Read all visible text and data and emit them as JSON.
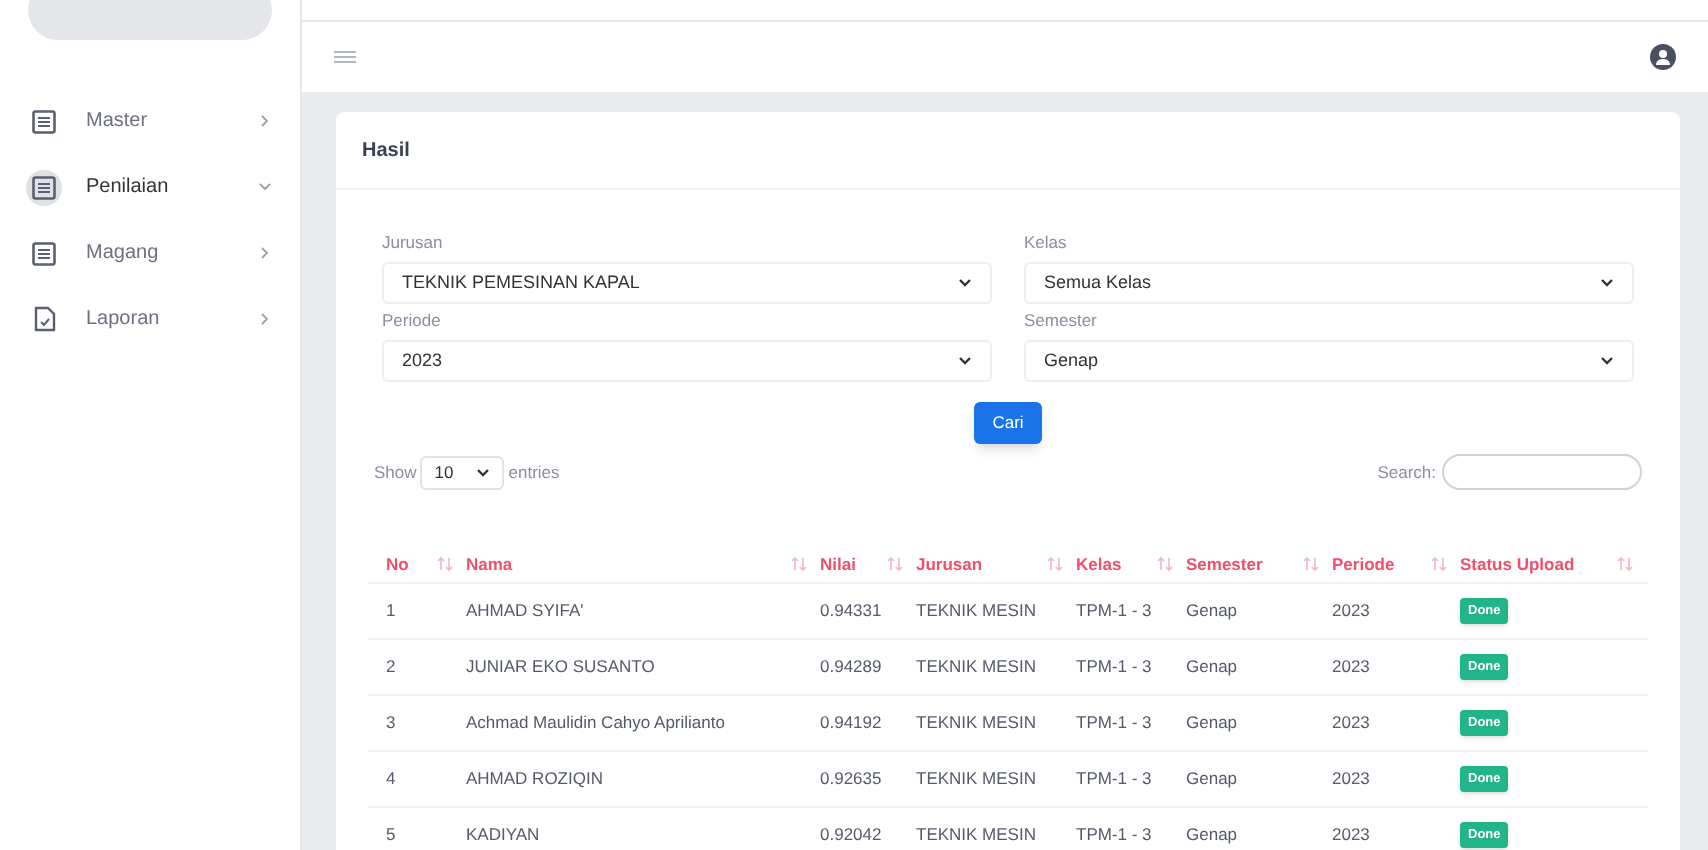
{
  "sidebar": {
    "items": [
      {
        "label": "Master",
        "selected": false,
        "expanded": false,
        "kind": "list"
      },
      {
        "label": "Penilaian",
        "selected": true,
        "expanded": true,
        "kind": "list"
      },
      {
        "label": "Magang",
        "selected": false,
        "expanded": false,
        "kind": "list"
      },
      {
        "label": "Laporan",
        "selected": false,
        "expanded": false,
        "kind": "file"
      }
    ]
  },
  "card": {
    "title": "Hasil",
    "filters": [
      {
        "label": "Jurusan",
        "value": "TEKNIK PEMESINAN KAPAL"
      },
      {
        "label": "Kelas",
        "value": "Semua Kelas"
      },
      {
        "label": "Periode",
        "value": "2023"
      },
      {
        "label": "Semester",
        "value": "Genap"
      }
    ],
    "search_button": "Cari",
    "length": {
      "before": "Show",
      "value": "10",
      "after": "entries"
    },
    "search_label": "Search:",
    "table": {
      "columns": [
        "No",
        "Nama",
        "Nilai",
        "Jurusan",
        "Kelas",
        "Semester",
        "Periode",
        "Status Upload"
      ],
      "rows": [
        [
          "1",
          "AHMAD SYIFA'",
          "0.94331",
          "TEKNIK MESIN",
          "TPM-1 - 3",
          "Genap",
          "2023",
          "Done"
        ],
        [
          "2",
          "JUNIAR EKO SUSANTO",
          "0.94289",
          "TEKNIK MESIN",
          "TPM-1 - 3",
          "Genap",
          "2023",
          "Done"
        ],
        [
          "3",
          "Achmad Maulidin Cahyo Aprilianto",
          "0.94192",
          "TEKNIK MESIN",
          "TPM-1 - 3",
          "Genap",
          "2023",
          "Done"
        ],
        [
          "4",
          "AHMAD ROZIQIN",
          "0.92635",
          "TEKNIK MESIN",
          "TPM-1 - 3",
          "Genap",
          "2023",
          "Done"
        ],
        [
          "5",
          "KADIYAN",
          "0.92042",
          "TEKNIK MESIN",
          "TPM-1 - 3",
          "Genap",
          "2023",
          "Done"
        ]
      ]
    }
  }
}
